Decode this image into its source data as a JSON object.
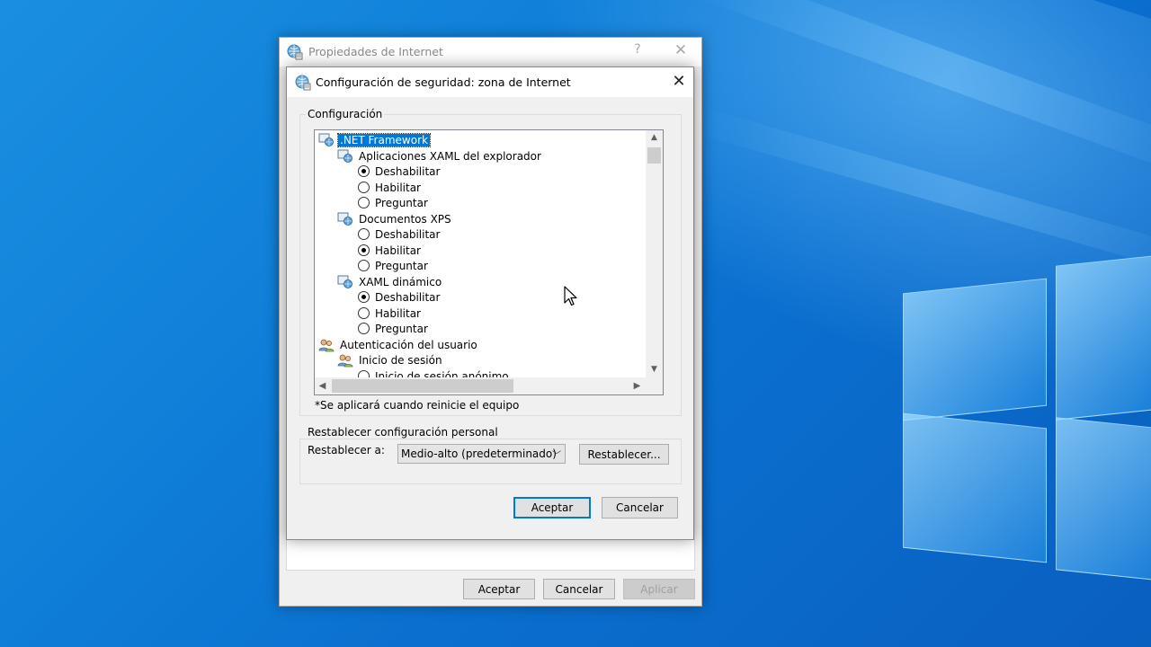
{
  "back_dialog": {
    "title": "Propiedades de Internet",
    "help_label": "?",
    "buttons": {
      "ok": "Aceptar",
      "cancel": "Cancelar",
      "apply": "Aplicar"
    }
  },
  "dialog": {
    "title": "Configuración de seguridad: zona de Internet",
    "config_group_label": "Configuración",
    "tree_items": [
      {
        "label": ".NET Framework",
        "type": "category",
        "selected": true
      },
      {
        "label": "Aplicaciones XAML del explorador",
        "type": "subcategory"
      },
      {
        "label": "Deshabilitar",
        "type": "radio",
        "checked": true
      },
      {
        "label": "Habilitar",
        "type": "radio",
        "checked": false
      },
      {
        "label": "Preguntar",
        "type": "radio",
        "checked": false
      },
      {
        "label": "Documentos XPS",
        "type": "subcategory"
      },
      {
        "label": "Deshabilitar",
        "type": "radio",
        "checked": false
      },
      {
        "label": "Habilitar",
        "type": "radio",
        "checked": true
      },
      {
        "label": "Preguntar",
        "type": "radio",
        "checked": false
      },
      {
        "label": "XAML dinámico",
        "type": "subcategory"
      },
      {
        "label": "Deshabilitar",
        "type": "radio",
        "checked": true
      },
      {
        "label": "Habilitar",
        "type": "radio",
        "checked": false
      },
      {
        "label": "Preguntar",
        "type": "radio",
        "checked": false
      },
      {
        "label": "Autenticación del usuario",
        "type": "category-user"
      },
      {
        "label": "Inicio de sesión",
        "type": "subcategory-user"
      },
      {
        "label": "Inicio de sesión anónimo",
        "type": "radio",
        "checked": false
      }
    ],
    "restart_note": "*Se aplicará cuando reinicie el equipo",
    "reset_group_label": "Restablecer configuración personal",
    "reset_to_label": "Restablecer a:",
    "reset_select_value": "Medio-alto (predeterminado)",
    "reset_button": "Restablecer...",
    "ok_button": "Aceptar",
    "cancel_button": "Cancelar",
    "close_glyph": "✕"
  }
}
